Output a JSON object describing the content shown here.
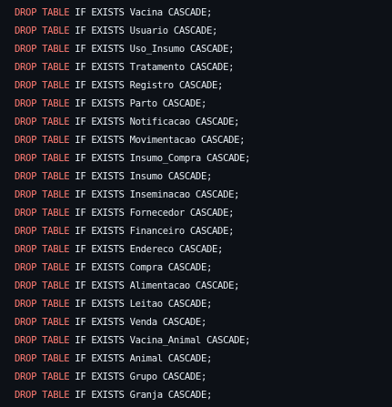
{
  "code": {
    "language": "sql",
    "keyword_color": "#ff7b72",
    "text_color": "#e6edf3",
    "background_color": "#0d1117",
    "keyword": "DROP TABLE",
    "lines": [
      {
        "keyword": "DROP TABLE",
        "rest": " IF EXISTS Vacina CASCADE;"
      },
      {
        "keyword": "DROP TABLE",
        "rest": " IF EXISTS Usuario CASCADE;"
      },
      {
        "keyword": "DROP TABLE",
        "rest": " IF EXISTS Uso_Insumo CASCADE;"
      },
      {
        "keyword": "DROP TABLE",
        "rest": " IF EXISTS Tratamento CASCADE;"
      },
      {
        "keyword": "DROP TABLE",
        "rest": " IF EXISTS Registro CASCADE;"
      },
      {
        "keyword": "DROP TABLE",
        "rest": " IF EXISTS Parto CASCADE;"
      },
      {
        "keyword": "DROP TABLE",
        "rest": " IF EXISTS Notificacao CASCADE;"
      },
      {
        "keyword": "DROP TABLE",
        "rest": " IF EXISTS Movimentacao CASCADE;"
      },
      {
        "keyword": "DROP TABLE",
        "rest": " IF EXISTS Insumo_Compra CASCADE;"
      },
      {
        "keyword": "DROP TABLE",
        "rest": " IF EXISTS Insumo CASCADE;"
      },
      {
        "keyword": "DROP TABLE",
        "rest": " IF EXISTS Inseminacao CASCADE;"
      },
      {
        "keyword": "DROP TABLE",
        "rest": " IF EXISTS Fornecedor CASCADE;"
      },
      {
        "keyword": "DROP TABLE",
        "rest": " IF EXISTS Financeiro CASCADE;"
      },
      {
        "keyword": "DROP TABLE",
        "rest": " IF EXISTS Endereco CASCADE;"
      },
      {
        "keyword": "DROP TABLE",
        "rest": " IF EXISTS Compra CASCADE;"
      },
      {
        "keyword": "DROP TABLE",
        "rest": " IF EXISTS Alimentacao CASCADE;"
      },
      {
        "keyword": "DROP TABLE",
        "rest": " IF EXISTS Leitao CASCADE;"
      },
      {
        "keyword": "DROP TABLE",
        "rest": " IF EXISTS Venda CASCADE;"
      },
      {
        "keyword": "DROP TABLE",
        "rest": " IF EXISTS Vacina_Animal CASCADE;"
      },
      {
        "keyword": "DROP TABLE",
        "rest": " IF EXISTS Animal CASCADE;"
      },
      {
        "keyword": "DROP TABLE",
        "rest": " IF EXISTS Grupo CASCADE;"
      },
      {
        "keyword": "DROP TABLE",
        "rest": " IF EXISTS Granja CASCADE;"
      }
    ]
  }
}
